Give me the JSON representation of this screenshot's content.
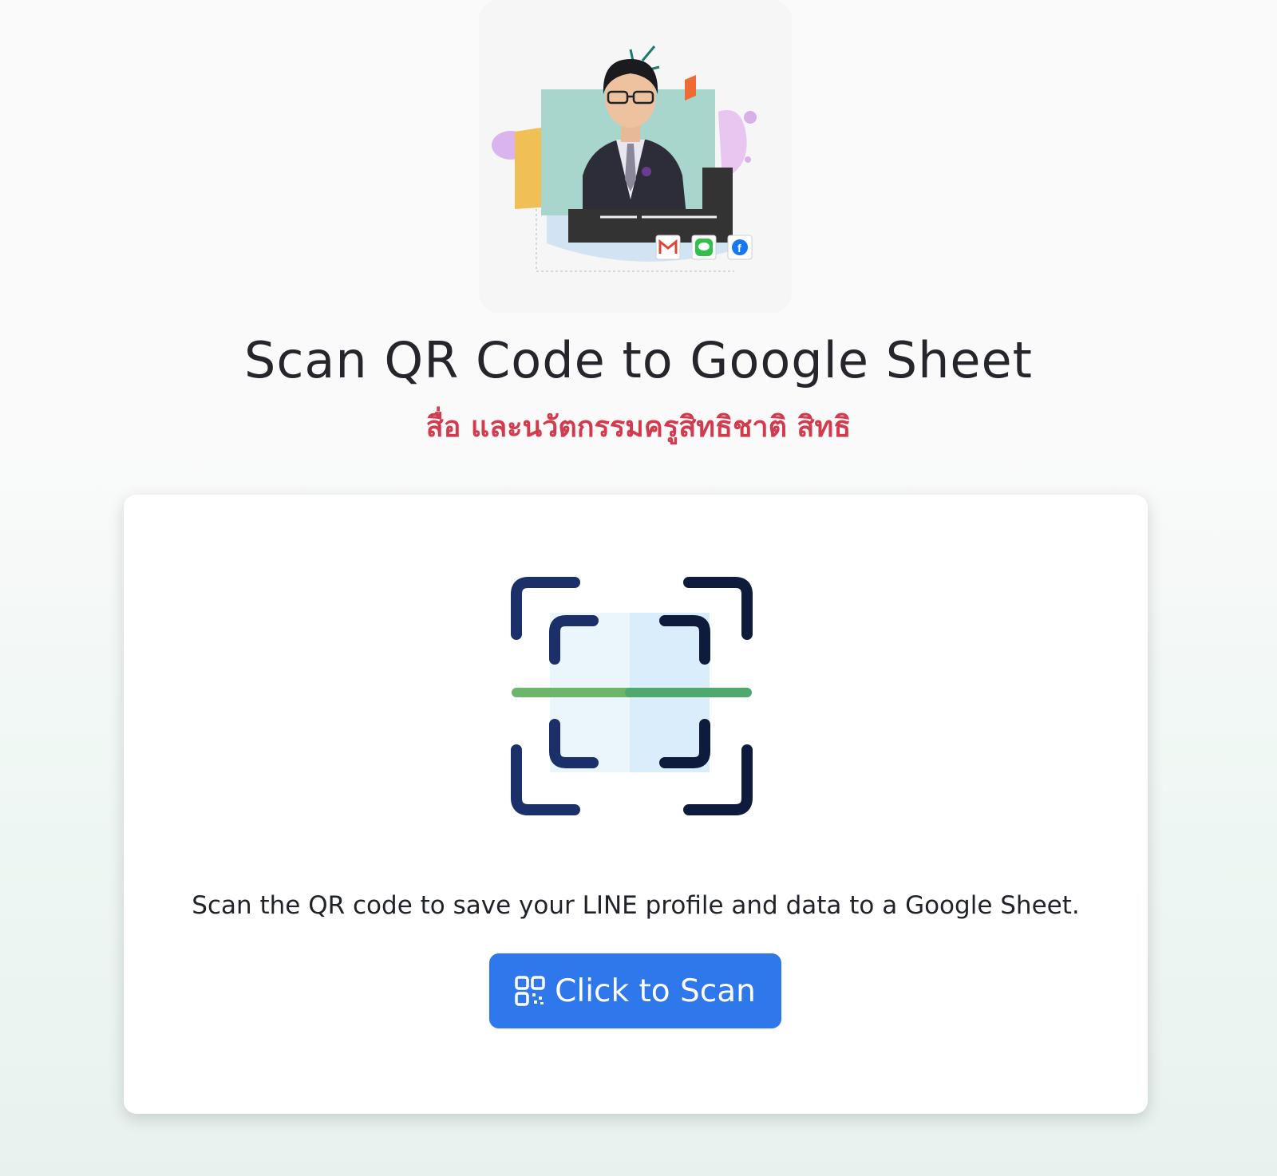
{
  "page": {
    "title": "Scan QR Code to Google Sheet",
    "subtitle": "สื่อ และนวัตกรรมครูสิทธิชาติ สิทธิ"
  },
  "hero": {
    "illustration": "teacher-portrait-illustration",
    "social_icons": [
      "gmail-icon",
      "line-icon",
      "facebook-icon"
    ]
  },
  "card": {
    "graphic": "qr-scan-frame-icon",
    "description": "Scan the QR code to save your LINE profile and data to a Google Sheet.",
    "button_icon": "qr-code-icon",
    "button_label": "Click to Scan"
  },
  "colors": {
    "title": "#24262b",
    "subtitle": "#d23a4e",
    "button": "#2f78eb",
    "scan_line": "#5fb068",
    "frame_outer": "#1b2f68",
    "frame_dark": "#0f1b3d"
  }
}
